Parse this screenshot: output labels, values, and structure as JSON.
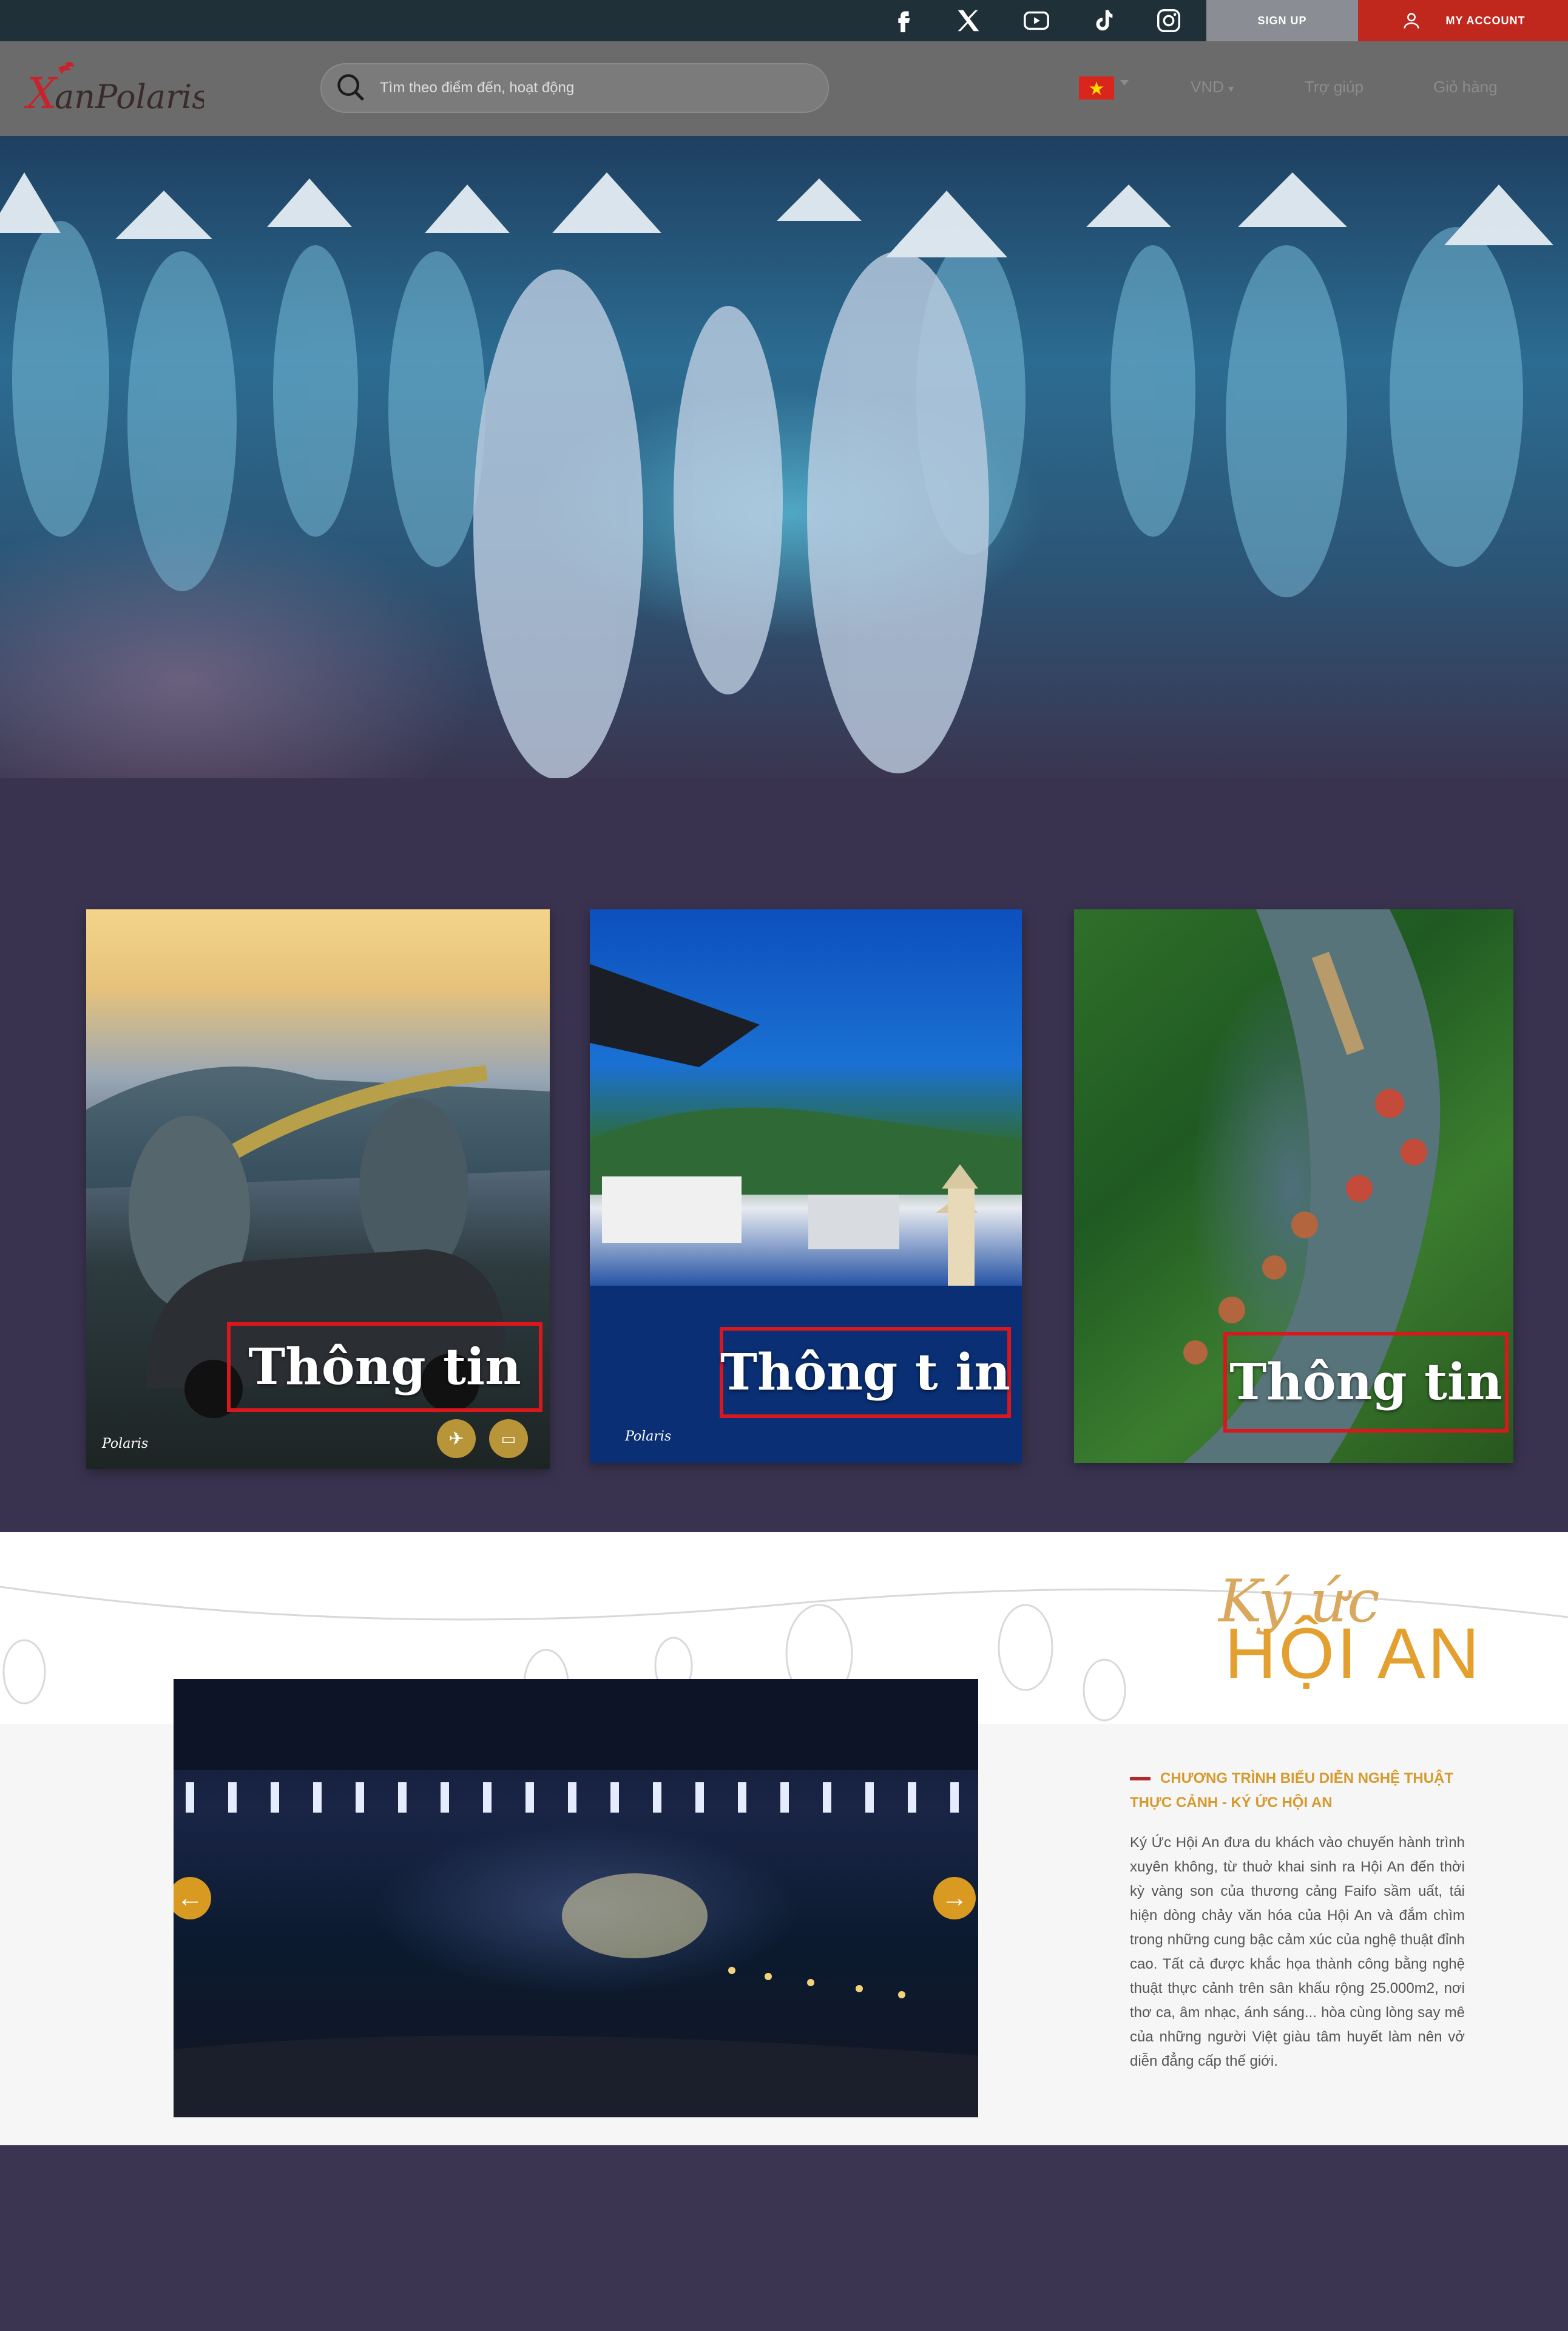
{
  "topbar": {
    "social": [
      "facebook-icon",
      "x-icon",
      "youtube-icon",
      "tiktok-icon",
      "instagram-icon"
    ],
    "signup_label": "SIGN UP",
    "account_label": "MY ACCOUNT"
  },
  "header": {
    "logo_text": "XanPolaris",
    "search_placeholder": "Tìm theo điểm đến, hoạt động",
    "language": "VND",
    "nav": [
      "Trợ giúp",
      "Giỏ hàng"
    ]
  },
  "cards": [
    {
      "label": "Thông tin",
      "logo_text": "Polaris"
    },
    {
      "label": "Thông t in",
      "logo_text": "Polaris"
    },
    {
      "label": "Thông tin"
    }
  ],
  "hoian": {
    "script_title": "Ký ức",
    "big_title": "HỘI AN",
    "subtitle": "CHƯƠNG TRÌNH BIỂU DIỄN NGHỆ THUẬT THỰC CẢNH - KÝ ỨC HỘI AN",
    "body": "Ký Ức Hội An đưa du khách vào chuyến hành trình xuyên không, từ thuở khai sinh ra Hội An đến thời kỳ vàng son của thương cảng Faifo sầm uất, tái hiện dòng chảy văn hóa của Hội An và đắm chìm trong những cung bậc cảm xúc của nghệ thuật đỉnh cao. Tất cả được khắc họa thành công bằng nghệ thuật thực cảnh trên sân khấu rộng 25.000m2, nơi thơ ca, âm nhạc, ánh sáng... hòa cùng lòng say mê của những người Việt giàu tâm huyết làm nên vở diễn đẳng cấp thế giới."
  },
  "colors": {
    "topbar": "#1f3038",
    "header": "#6b6b6b",
    "signup": "#8a8d93",
    "account": "#c0281e",
    "section_bg": "#3a3350",
    "accent_gold": "#d99a22",
    "box_red": "#d9171c"
  }
}
